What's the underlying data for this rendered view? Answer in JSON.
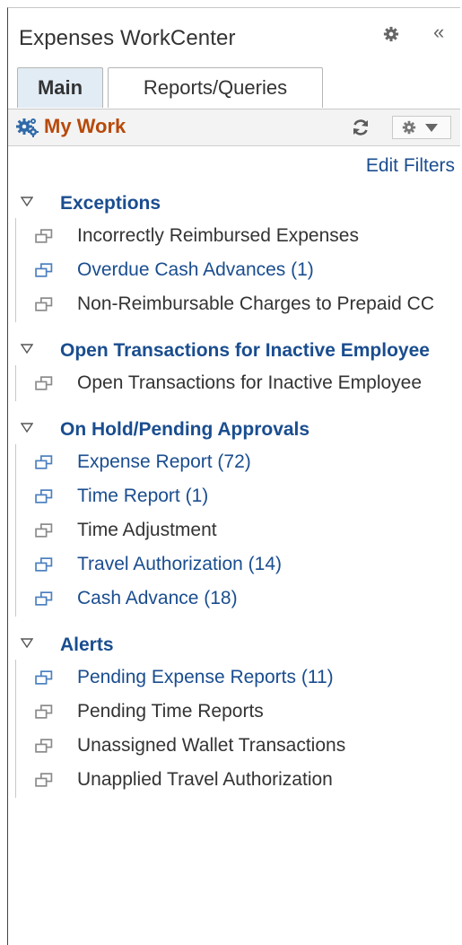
{
  "header": {
    "title": "Expenses WorkCenter",
    "gear_icon": "gear-icon",
    "collapse_label": "«"
  },
  "tabs": [
    {
      "label": "Main",
      "active": true
    },
    {
      "label": "Reports/Queries",
      "active": false
    }
  ],
  "pagelet": {
    "title": "My Work",
    "icon": "gears-icon",
    "refresh_icon": "refresh-icon",
    "actions_icon": "gear-dropdown-icon"
  },
  "edit_filters_label": "Edit Filters",
  "colors": {
    "link": "#1a4d8f",
    "pagelet_title": "#b74a0a",
    "text": "#333333",
    "tab_active_bg": "#e1ecf5"
  },
  "sections": [
    {
      "title": "Exceptions",
      "items": [
        {
          "label": "Incorrectly Reimbursed Expenses",
          "link": false
        },
        {
          "label": "Overdue Cash Advances (1)",
          "link": true
        },
        {
          "label": "Non-Reimbursable Charges to Prepaid CC",
          "link": false
        }
      ]
    },
    {
      "title": "Open Transactions for Inactive Employee",
      "items": [
        {
          "label": "Open Transactions for Inactive Employee",
          "link": false
        }
      ]
    },
    {
      "title": "On Hold/Pending Approvals",
      "items": [
        {
          "label": "Expense Report (72)",
          "link": true
        },
        {
          "label": "Time Report (1)",
          "link": true
        },
        {
          "label": "Time Adjustment",
          "link": false
        },
        {
          "label": "Travel Authorization (14)",
          "link": true
        },
        {
          "label": "Cash Advance (18)",
          "link": true
        }
      ]
    },
    {
      "title": "Alerts",
      "items": [
        {
          "label": "Pending Expense Reports (11)",
          "link": true
        },
        {
          "label": "Pending Time Reports",
          "link": false
        },
        {
          "label": "Unassigned Wallet Transactions",
          "link": false
        },
        {
          "label": "Unapplied Travel Authorization",
          "link": false
        }
      ]
    }
  ]
}
